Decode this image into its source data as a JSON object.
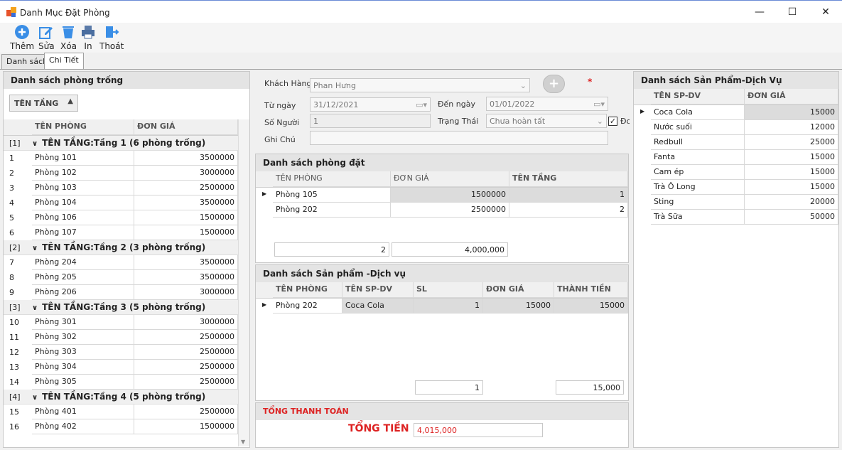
{
  "window": {
    "title": "Danh Mục Đặt Phòng",
    "min": "—",
    "max": "☐",
    "close": "✕"
  },
  "toolbar": {
    "add": "Thêm",
    "edit": "Sửa",
    "delete": "Xóa",
    "print": "In",
    "exit": "Thoát"
  },
  "tabs": [
    "Danh sách",
    "Chi Tiết"
  ],
  "left": {
    "title": "Danh sách phòng trống",
    "group_by": "TÊN TẦNG",
    "col_room": "TÊN PHÒNG",
    "col_price": "ĐƠN GIÁ",
    "groups": [
      {
        "idx": "[1]",
        "label": "TÊN TẦNG:Tầng 1 (6 phòng trống)",
        "rows": [
          [
            "1",
            "Phòng 101",
            "3500000"
          ],
          [
            "2",
            "Phòng 102",
            "3000000"
          ],
          [
            "3",
            "Phòng 103",
            "2500000"
          ],
          [
            "4",
            "Phòng 104",
            "3500000"
          ],
          [
            "5",
            "Phòng 106",
            "1500000"
          ],
          [
            "6",
            "Phòng 107",
            "1500000"
          ]
        ]
      },
      {
        "idx": "[2]",
        "label": "TÊN TẦNG:Tầng 2 (3 phòng trống)",
        "rows": [
          [
            "7",
            "Phòng 204",
            "3500000"
          ],
          [
            "8",
            "Phòng 205",
            "3500000"
          ],
          [
            "9",
            "Phòng 206",
            "3000000"
          ]
        ]
      },
      {
        "idx": "[3]",
        "label": "TÊN TẦNG:Tầng 3 (5 phòng trống)",
        "rows": [
          [
            "10",
            "Phòng 301",
            "3000000"
          ],
          [
            "11",
            "Phòng 302",
            "2500000"
          ],
          [
            "12",
            "Phòng 303",
            "2500000"
          ],
          [
            "13",
            "Phòng 304",
            "2500000"
          ],
          [
            "14",
            "Phòng 305",
            "2500000"
          ]
        ]
      },
      {
        "idx": "[4]",
        "label": "TÊN TẦNG:Tầng 4 (5 phòng trống)",
        "rows": [
          [
            "15",
            "Phòng 401",
            "2500000"
          ],
          [
            "16",
            "Phòng 402",
            "1500000"
          ]
        ]
      }
    ]
  },
  "form": {
    "customer_label": "Khách Hàng",
    "customer": "Phan Hưng",
    "required": "*",
    "from_label": "Từ ngày",
    "from": "31/12/2021",
    "to_label": "Đến ngày",
    "to": "01/01/2022",
    "people_label": "Số Người",
    "people": "1",
    "status_label": "Trạng Thái",
    "status": "Chưa hoàn tất",
    "check_label": "Đơ",
    "note_label": "Ghi Chú",
    "note": ""
  },
  "booked": {
    "title": "Danh sách phòng đặt",
    "cols": [
      "TÊN PHÒNG",
      "ĐƠN GIÁ",
      "TÊN TẦNG"
    ],
    "rows": [
      [
        "Phòng 105",
        "1500000",
        "1"
      ],
      [
        "Phòng 202",
        "2500000",
        "2"
      ]
    ],
    "sum_count": "2",
    "sum_total": "4,000,000"
  },
  "services": {
    "title": "Danh sách Sản phẩm -Dịch vụ",
    "cols": [
      "TÊN PHÒNG",
      "TÊN SP-DV",
      "SL",
      "ĐƠN GIÁ",
      "THÀNH TIỀN"
    ],
    "rows": [
      [
        "Phòng 202",
        "Coca Cola",
        "1",
        "15000",
        "15000"
      ]
    ],
    "sum_qty": "1",
    "sum_total": "15,000"
  },
  "payment": {
    "title": "TỔNG THANH TOÁN",
    "total_label": "TỔNG TIỀN",
    "total": "4,015,000"
  },
  "right": {
    "title": "Danh sách Sản Phẩm-Dịch Vụ",
    "cols": [
      "TÊN SP-DV",
      "ĐƠN GIÁ"
    ],
    "rows": [
      [
        "Coca Cola",
        "15000"
      ],
      [
        "Nước suối",
        "12000"
      ],
      [
        "Redbull",
        "25000"
      ],
      [
        "Fanta",
        "15000"
      ],
      [
        "Cam ép",
        "15000"
      ],
      [
        "Trà Ô Long",
        "15000"
      ],
      [
        "Sting",
        "20000"
      ],
      [
        "Trà Sữa",
        "50000"
      ]
    ]
  },
  "colors": {
    "accent": "#d22",
    "primary_icon": "#3a8ee6"
  }
}
